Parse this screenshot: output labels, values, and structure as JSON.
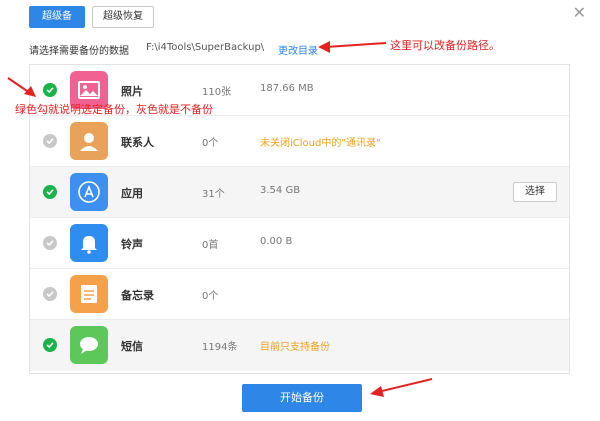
{
  "toolbar": {
    "tab_backup": "超级备份",
    "tab_restore": "超级恢复",
    "close": "✕"
  },
  "path": {
    "label": "请选择需要备份的数据",
    "value": "F:\\i4Tools\\SuperBackup\\",
    "change": "更改目录"
  },
  "items": [
    {
      "name": "照片",
      "count": "110张",
      "info": "187.66 MB",
      "checked": true,
      "icon": "photo-icon",
      "color": "#f06292"
    },
    {
      "name": "联系人",
      "count": "0个",
      "info": "未关闭iCloud中的\"通讯录\"",
      "checked": false,
      "icon": "contacts-icon",
      "color": "#e8a25a"
    },
    {
      "name": "应用",
      "count": "31个",
      "info": "3.54 GB",
      "checked": true,
      "icon": "app-store-icon",
      "color": "#3d8ff0",
      "select": "选择"
    },
    {
      "name": "铃声",
      "count": "0首",
      "info": "0.00 B",
      "checked": false,
      "icon": "bell-icon",
      "color": "#2f8df0"
    },
    {
      "name": "备忘录",
      "count": "0个",
      "info": "",
      "checked": false,
      "icon": "notes-icon",
      "color": "#f5a04a"
    },
    {
      "name": "短信",
      "count": "1194条",
      "info": "目前只支持备份",
      "checked": true,
      "icon": "message-icon",
      "color": "#5dc75a"
    }
  ],
  "start_button": "开始备份",
  "annotations": {
    "path_note": "这里可以改备份路径。",
    "check_note": "绿色勾就说明选定备份，灰色就是不备份"
  },
  "colors": {
    "accent": "#2e86e6",
    "checked": "#19b34a",
    "unchecked": "#c8c8c8",
    "warning": "#f0a020",
    "annotation": "#e52222"
  }
}
